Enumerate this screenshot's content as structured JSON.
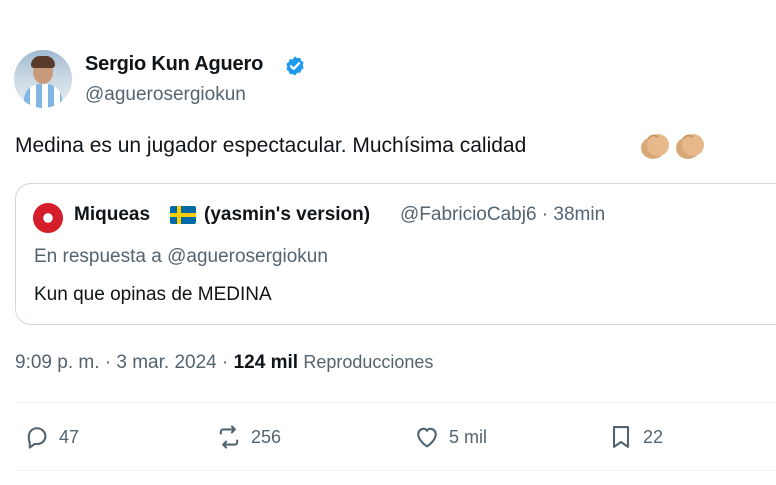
{
  "author": {
    "display_name": "Sergio Kun Aguero",
    "handle": "@aguerosergiokun",
    "verified_icon": "verified-badge-icon",
    "verified_color": "#1d9bf0"
  },
  "tweet": {
    "text": "Medina es un jugador espectacular. Muchísima calidad",
    "emoji": [
      "clapping-hands-icon",
      "clapping-hands-icon"
    ]
  },
  "quote": {
    "display_name": "Miqueas",
    "flag_icon": "sweden-flag-icon",
    "name_suffix": "(yasmin's version)",
    "meta": "@FabricioCabj6 · 38min",
    "reply_to": "En respuesta a @aguerosergiokun",
    "text": "Kun que opinas de MEDINA"
  },
  "meta": {
    "timestamp": "9:09 p. m. · 3 mar. 2024 · ",
    "views_count": "124 mil",
    "views_label": "Reproducciones"
  },
  "actions": {
    "replies": "47",
    "retweets": "256",
    "likes": "5 mil",
    "bookmarks": "22"
  },
  "colors": {
    "text": "#0f1419",
    "secondary": "#536471",
    "border": "#cfd9de",
    "divider": "#eff3f4"
  }
}
